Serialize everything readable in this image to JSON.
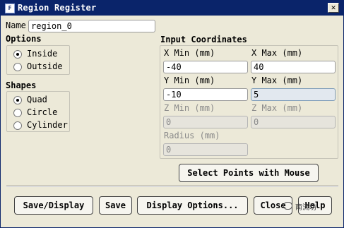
{
  "window": {
    "title": "Region Register",
    "icon": "fluent-app-icon",
    "close": "✕"
  },
  "name": {
    "label": "Name",
    "value": "region_0"
  },
  "options": {
    "label": "Options",
    "items": [
      {
        "label": "Inside",
        "selected": true
      },
      {
        "label": "Outside",
        "selected": false
      }
    ]
  },
  "shapes": {
    "label": "Shapes",
    "items": [
      {
        "label": "Quad",
        "selected": true
      },
      {
        "label": "Circle",
        "selected": false
      },
      {
        "label": "Cylinder",
        "selected": false
      }
    ]
  },
  "coords": {
    "label": "Input Coordinates",
    "x_min": {
      "label": "X Min (mm)",
      "value": "-40"
    },
    "x_max": {
      "label": "X Max (mm)",
      "value": "40"
    },
    "y_min": {
      "label": "Y Min (mm)",
      "value": "-10"
    },
    "y_max": {
      "label": "Y Max (mm)",
      "value": "5"
    },
    "z_min": {
      "label": "Z Min (mm)",
      "value": "0"
    },
    "z_max": {
      "label": "Z Max (mm)",
      "value": "0"
    },
    "radius": {
      "label": "Radius (mm)",
      "value": "0"
    }
  },
  "select_points": "Select Points with Mouse",
  "buttons": {
    "save_display": "Save/Display",
    "save": "Save",
    "display_options": "Display Options...",
    "close": "Close",
    "help": "Help"
  },
  "watermark": {
    "text": "南流坊",
    "icon": "wechat-icon"
  }
}
